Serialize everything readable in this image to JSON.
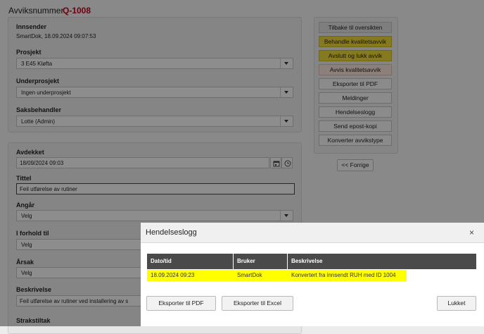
{
  "header": {
    "title": "Avviksnummer",
    "number": "Q-1008"
  },
  "form": {
    "innsender_label": "Innsender",
    "innsender_value": "SmartDok, 18.09.2024 09:07:53",
    "prosjekt_label": "Prosjekt",
    "prosjekt_value": "3 E45 Kløfta",
    "underprosjekt_label": "Underprosjekt",
    "underprosjekt_value": "Ingen underprosjekt",
    "saksbehandler_label": "Saksbehandler",
    "saksbehandler_value": "Lotte (Admin)",
    "avdekket_label": "Avdekket",
    "avdekket_value": "18/09/2024 09:03",
    "tittel_label": "Tittel",
    "tittel_value": "Feil utførelse av rutiner",
    "angar_label": "Angår",
    "angar_value": "Velg",
    "i_forhold_til_label": "I forhold til",
    "i_forhold_til_value": "Velg",
    "arsak_label": "Årsak",
    "arsak_value": "Velg",
    "beskrivelse_label": "Beskrivelse",
    "beskrivelse_value": "Feil utførelse av rutiner ved installering av s",
    "strakstiltak_label": "Strakstiltak"
  },
  "actions": {
    "back": "Tilbake til oversikten",
    "handle": "Behandle kvalitetsavvik",
    "close": "Avslutt og lukk avvik",
    "reject": "Avvis kvalitetsavvik",
    "export_pdf": "Eksporter til PDF",
    "messages": "Meldinger",
    "event_log": "Hendelseslogg",
    "send_email": "Send epost-kopi",
    "convert": "Konverter avvikstype",
    "previous": "<< Forrige"
  },
  "colors": {
    "accent_red": "#c0001a",
    "handle_bg": "#e7d23a",
    "close_bg": "#e7d23a",
    "reject_bg": "#f2dcd6",
    "highlight_row": "#ffff00",
    "table_header": "#4a4a4a"
  },
  "modal": {
    "title": "Hendelseslogg",
    "close_icon": "×",
    "columns": [
      "Dato/tid",
      "Bruker",
      "Beskrivelse"
    ],
    "rows": [
      [
        "18.09.2024 09:23",
        "SmartDok",
        "Konvertert fra innsendt RUH med ID 1004"
      ]
    ],
    "export_pdf": "Eksporter til PDF",
    "export_excel": "Eksporter til Excel",
    "close_button": "Lukket"
  }
}
